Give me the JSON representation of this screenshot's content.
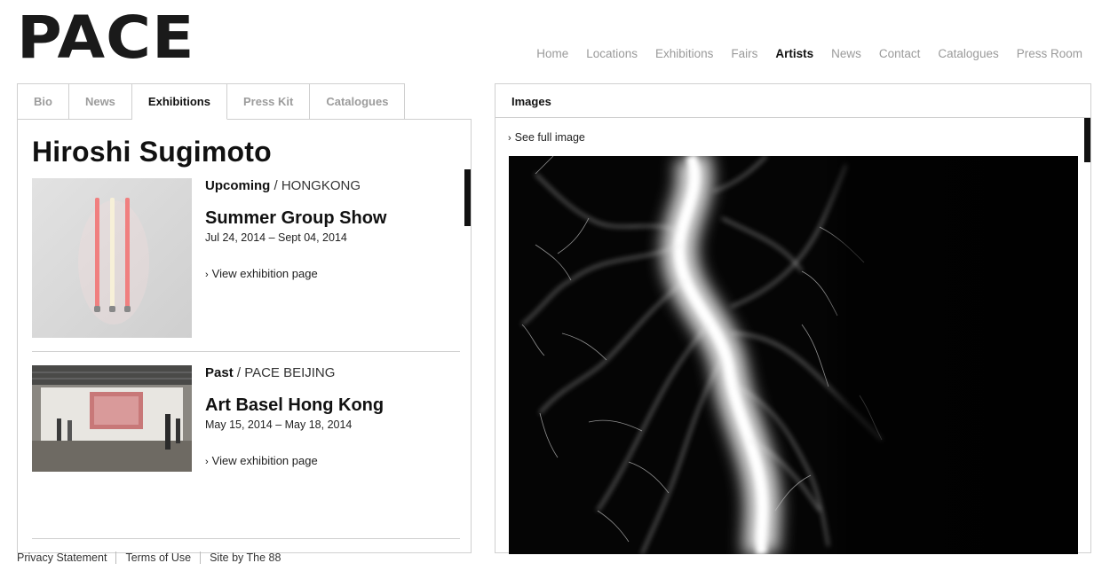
{
  "logo": "PACE",
  "nav": [
    "Home",
    "Locations",
    "Exhibitions",
    "Fairs",
    "Artists",
    "News",
    "Contact",
    "Catalogues",
    "Press Room"
  ],
  "nav_active": "Artists",
  "tabs": [
    "Bio",
    "News",
    "Exhibitions",
    "Press Kit",
    "Catalogues"
  ],
  "tab_active": "Exhibitions",
  "artist": "Hiroshi Sugimoto",
  "exhibitions": [
    {
      "status": "Upcoming",
      "location": " / HONGKONG",
      "title": "Summer Group Show",
      "dates": "Jul 24, 2014 – Sept 04, 2014",
      "link": "View exhibition page"
    },
    {
      "status": "Past",
      "location": " / PACE BEIJING",
      "title": "Art Basel Hong Kong",
      "dates": "May 15, 2014 – May 18, 2014",
      "link": "View exhibition page"
    }
  ],
  "images_panel": {
    "title": "Images",
    "see_full": "See full image"
  },
  "footer": [
    "Privacy Statement",
    "Terms of Use",
    "Site by The 88"
  ],
  "colors": {
    "text": "#111111",
    "muted": "#9a9a9a",
    "border": "#cfcfcf",
    "image_bg": "#000000"
  }
}
